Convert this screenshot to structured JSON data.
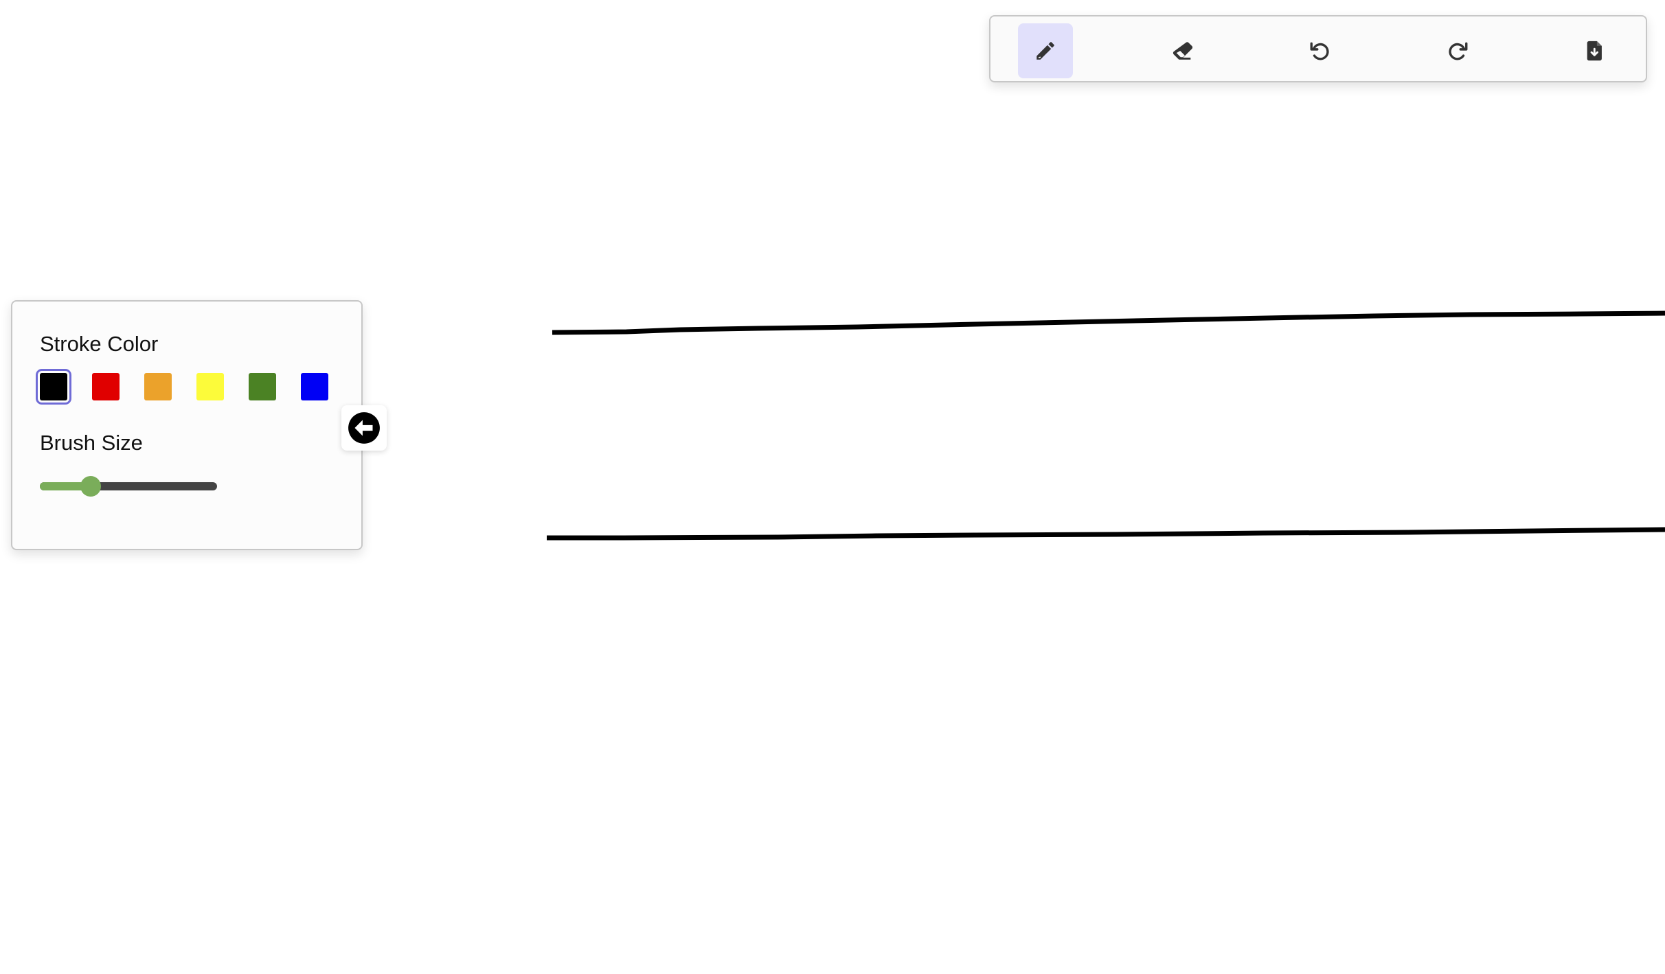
{
  "toolbar": {
    "tools": [
      {
        "name": "pencil-tool",
        "icon": "pencil-icon",
        "active": true
      },
      {
        "name": "eraser-tool",
        "icon": "eraser-icon",
        "active": false
      },
      {
        "name": "undo-tool",
        "icon": "undo-icon",
        "active": false
      },
      {
        "name": "redo-tool",
        "icon": "redo-icon",
        "active": false
      },
      {
        "name": "export-tool",
        "icon": "file-download-icon",
        "active": false
      }
    ],
    "active_color": "#e1e0fb"
  },
  "panel": {
    "stroke_color_label": "Stroke Color",
    "brush_size_label": "Brush Size",
    "colors": [
      "#000000",
      "#e00000",
      "#eba22b",
      "#fcfb3a",
      "#4b8224",
      "#0000f5"
    ],
    "selected_color_index": 0,
    "brush_size_fraction": 0.26,
    "slider_fill_color": "#7aad5a",
    "collapse_icon": "arrow-left-circle-icon"
  },
  "canvas": {
    "stroke_color": "#000000"
  }
}
